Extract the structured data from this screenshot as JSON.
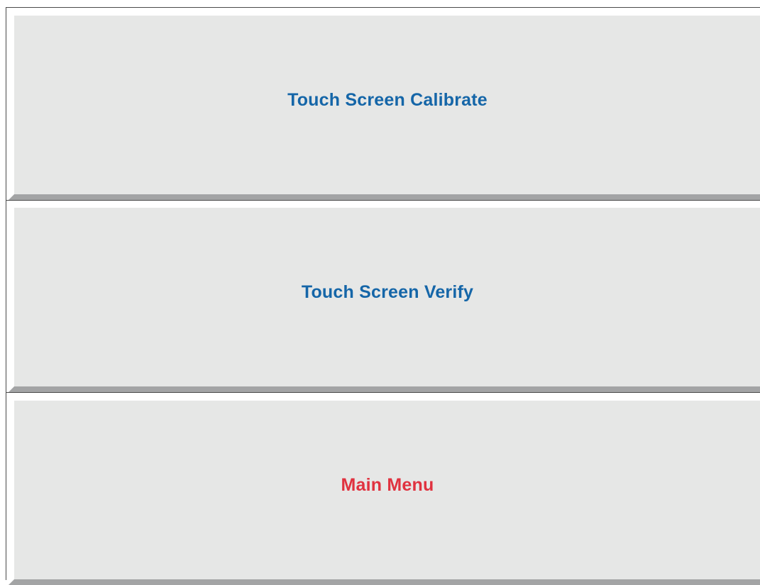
{
  "menu": {
    "items": [
      {
        "label": "Touch Screen Calibrate",
        "color": "#1566a8"
      },
      {
        "label": "Touch Screen Verify",
        "color": "#1566a8"
      },
      {
        "label": "Main Menu",
        "color": "#e0323f"
      }
    ]
  },
  "colors": {
    "button_face": "#e6e7e6",
    "button_shadow": "#a3a4a5",
    "border": "#4a4a4a"
  }
}
